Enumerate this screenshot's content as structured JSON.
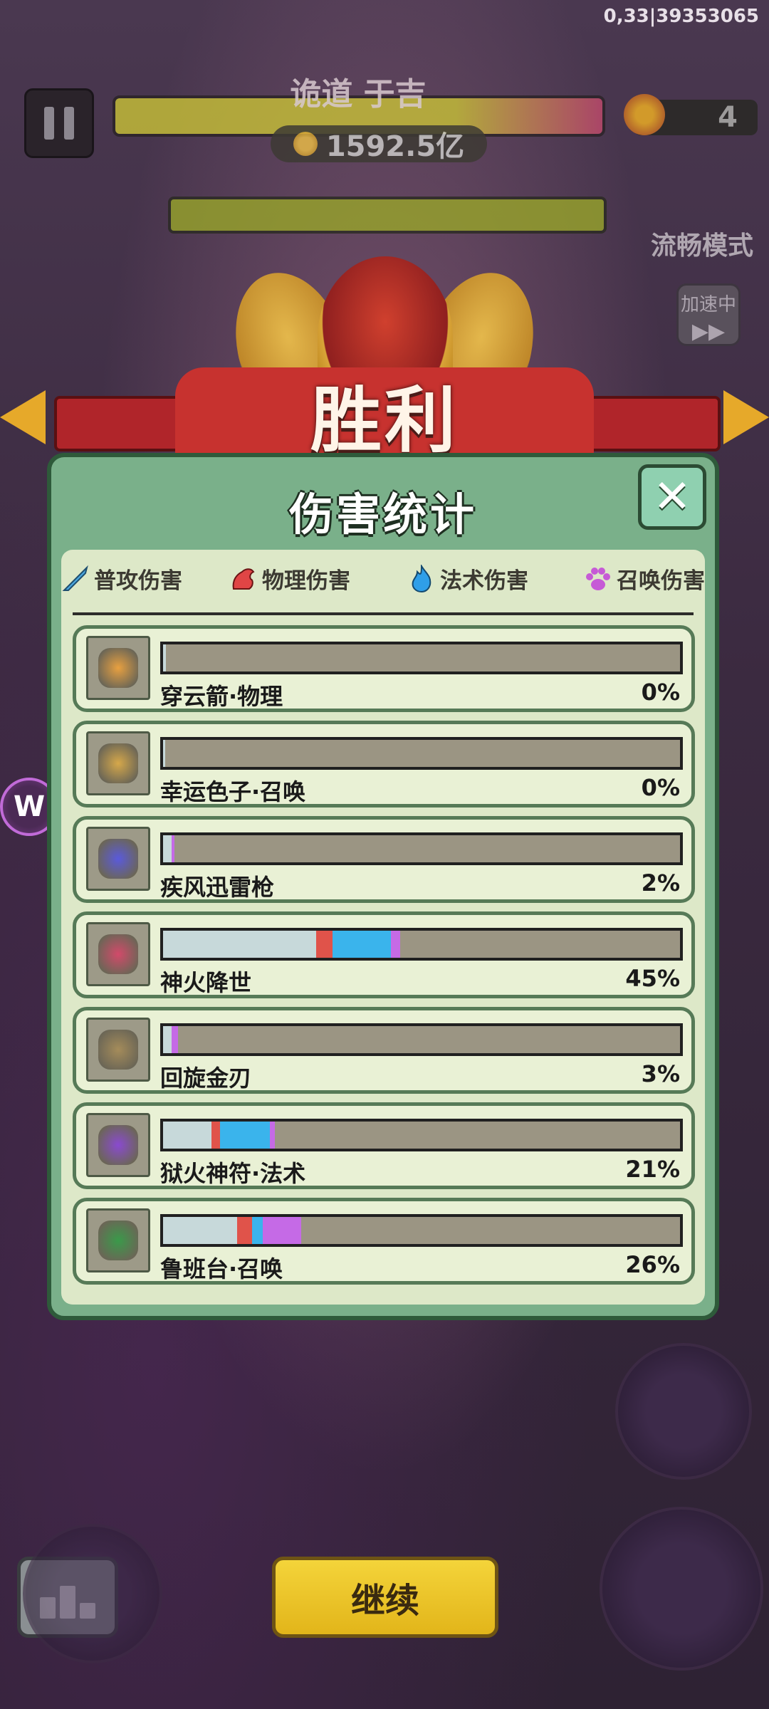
{
  "debug_text": "0,33|39353065",
  "hud": {
    "boss_name": "诡道 于吉",
    "gold": "1592.5亿",
    "wave": "4",
    "smooth_mode": "流畅模式",
    "speed_label": "加速中",
    "speed_arrows": "▶▶"
  },
  "victory": "胜利",
  "panel": {
    "title": "伤害统计",
    "close_glyph": "✕",
    "legend": [
      {
        "label": "普攻伤害",
        "icon": "sword-icon",
        "color": "#4aa8e0"
      },
      {
        "label": "物理伤害",
        "icon": "muscle-icon",
        "color": "#e04545"
      },
      {
        "label": "法术伤害",
        "icon": "flame-icon",
        "color": "#2f9fe8"
      },
      {
        "label": "召唤伤害",
        "icon": "paw-icon",
        "color": "#c65ad6"
      }
    ],
    "segment_colors": {
      "normal": "#c7d9da",
      "physical": "#e0534a",
      "magic": "#3ab4ec",
      "summon": "#c56ae6"
    },
    "skills": [
      {
        "name": "穿云箭·物理",
        "percent": "0%",
        "icon": "arrows-icon",
        "segments": [
          {
            "type": "normal",
            "w": 0.005
          }
        ]
      },
      {
        "name": "幸运色子·召唤",
        "percent": "0%",
        "icon": "dice-icon",
        "segments": [
          {
            "type": "normal",
            "w": 0.004
          }
        ]
      },
      {
        "name": "疾风迅雷枪",
        "percent": "2%",
        "icon": "lightning-spear-icon",
        "segments": [
          {
            "type": "normal",
            "w": 0.016
          },
          {
            "type": "summon",
            "w": 0.006
          }
        ]
      },
      {
        "name": "神火降世",
        "percent": "45%",
        "icon": "divine-fire-icon",
        "segments": [
          {
            "type": "normal",
            "w": 0.296
          },
          {
            "type": "physical",
            "w": 0.031
          },
          {
            "type": "magic",
            "w": 0.113
          },
          {
            "type": "summon",
            "w": 0.018
          }
        ]
      },
      {
        "name": "回旋金刃",
        "percent": "3%",
        "icon": "boomerang-blade-icon",
        "segments": [
          {
            "type": "normal",
            "w": 0.017
          },
          {
            "type": "summon",
            "w": 0.013
          }
        ]
      },
      {
        "name": "狱火神符·法术",
        "percent": "21%",
        "icon": "hellfire-talisman-icon",
        "segments": [
          {
            "type": "normal",
            "w": 0.093
          },
          {
            "type": "physical",
            "w": 0.017
          },
          {
            "type": "magic",
            "w": 0.097
          },
          {
            "type": "summon",
            "w": 0.009
          }
        ]
      },
      {
        "name": "鲁班台·召唤",
        "percent": "26%",
        "icon": "luban-platform-icon",
        "segments": [
          {
            "type": "normal",
            "w": 0.143
          },
          {
            "type": "physical",
            "w": 0.029
          },
          {
            "type": "magic",
            "w": 0.02
          },
          {
            "type": "summon",
            "w": 0.075
          }
        ]
      }
    ]
  },
  "buttons": {
    "continue": "继续",
    "side_badge": "W"
  }
}
